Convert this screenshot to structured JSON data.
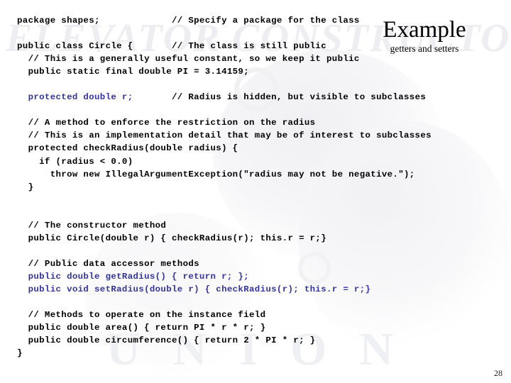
{
  "slide": {
    "title": "Example",
    "subtitle": "getters and setters",
    "page_number": "28",
    "watermark_top": "ELEVATOR CONSTRUCTORS",
    "watermark_bottom": "UNION",
    "accent_color": "#333399",
    "text_color": "#000000",
    "background_color": "#ffffff"
  },
  "code": {
    "language": "java",
    "lines": [
      {
        "text": "package shapes;             // Specify a package for the class",
        "color": "black"
      },
      {
        "text": "",
        "color": "black"
      },
      {
        "text": "public class Circle {       // The class is still public",
        "color": "black"
      },
      {
        "text": "  // This is a generally useful constant, so we keep it public",
        "color": "black"
      },
      {
        "text": "  public static final double PI = 3.14159;",
        "color": "black"
      },
      {
        "text": "",
        "color": "black"
      },
      {
        "text": "  protected double r;       // Radius is hidden, but visible to subclasses",
        "color": "mixed"
      },
      {
        "text": "",
        "color": "black"
      },
      {
        "text": "  // A method to enforce the restriction on the radius",
        "color": "black"
      },
      {
        "text": "  // This is an implementation detail that may be of interest to subclasses",
        "color": "black"
      },
      {
        "text": "  protected checkRadius(double radius) {",
        "color": "black"
      },
      {
        "text": "    if (radius < 0.0)",
        "color": "black"
      },
      {
        "text": "      throw new IllegalArgumentException(\"radius may not be negative.\");",
        "color": "black"
      },
      {
        "text": "  }",
        "color": "black"
      },
      {
        "text": "",
        "color": "black"
      },
      {
        "text": "",
        "color": "black"
      },
      {
        "text": "  // The constructor method",
        "color": "black"
      },
      {
        "text": "  public Circle(double r) { checkRadius(r); this.r = r;}",
        "color": "black"
      },
      {
        "text": "",
        "color": "black"
      },
      {
        "text": "  // Public data accessor methods",
        "color": "black"
      },
      {
        "text": "  public double getRadius() { return r; };",
        "color": "blue"
      },
      {
        "text": "  public void setRadius(double r) { checkRadius(r); this.r = r;}",
        "color": "blue"
      },
      {
        "text": "",
        "color": "black"
      },
      {
        "text": "  // Methods to operate on the instance field",
        "color": "black"
      },
      {
        "text": "  public double area() { return PI * r * r; }",
        "color": "black"
      },
      {
        "text": "  public double circumference() { return 2 * PI * r; }",
        "color": "black"
      },
      {
        "text": "}",
        "color": "black"
      }
    ],
    "mixed_line": {
      "indent": "  ",
      "blue_part": "protected double r;",
      "gap": "       ",
      "black_part": "// Radius is hidden, but visible to subclasses"
    }
  }
}
